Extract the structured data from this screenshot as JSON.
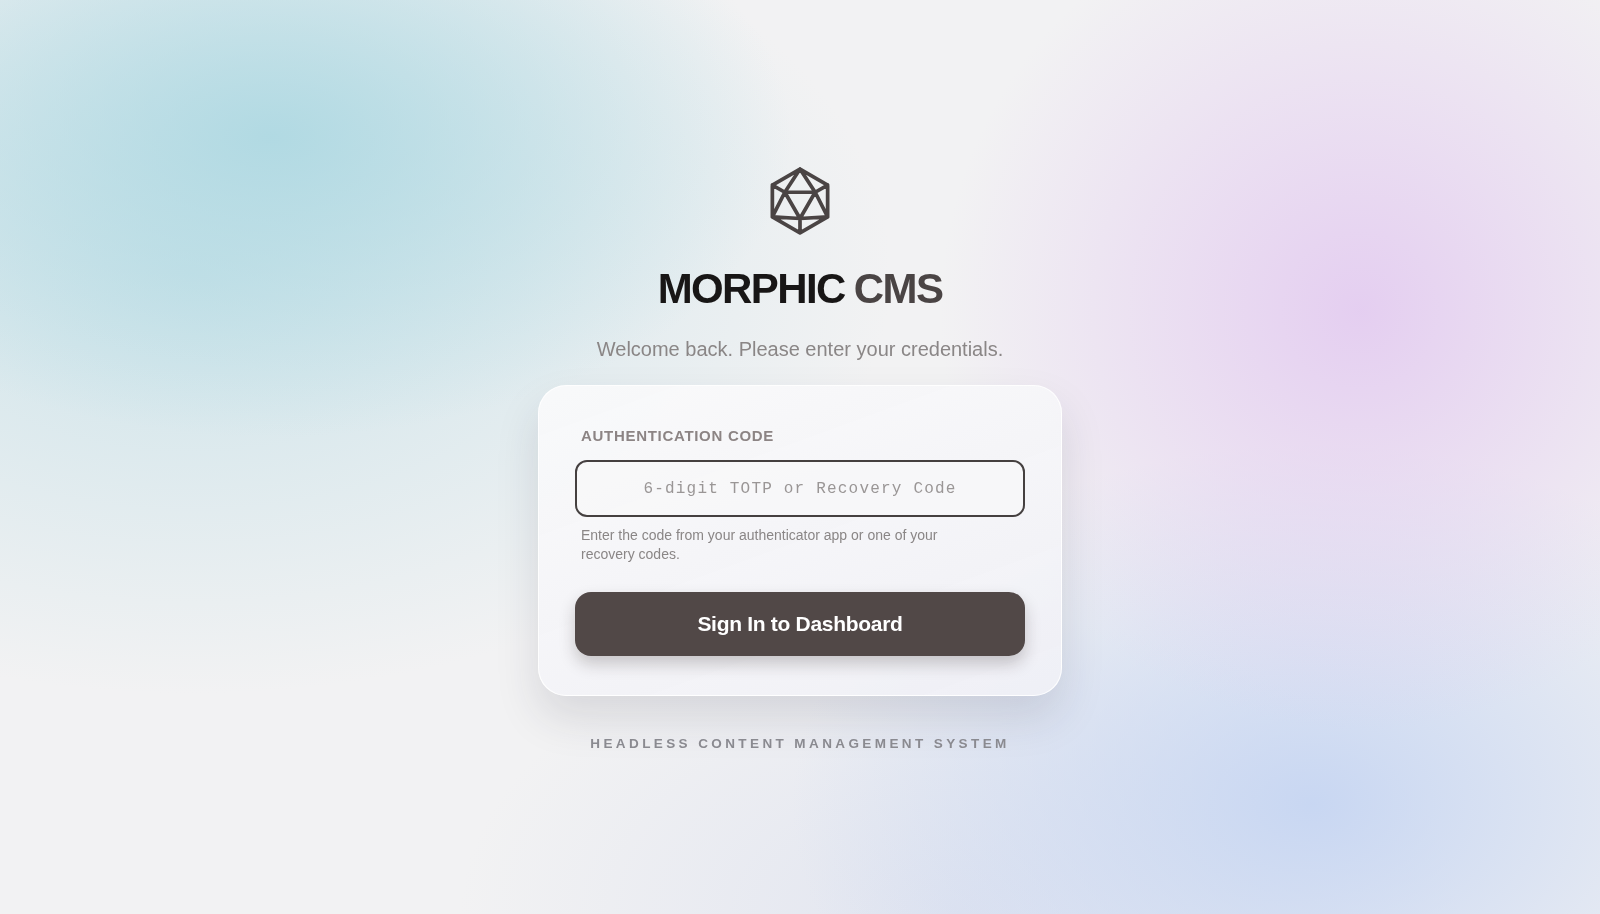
{
  "brand": {
    "name": "MORPHIC",
    "suffix": "CMS"
  },
  "subtitle": "Welcome back. Please enter your credentials.",
  "form": {
    "field": {
      "label": "AUTHENTICATION CODE",
      "placeholder": "6-digit TOTP or Recovery Code",
      "help": "Enter the code from your authenticator app or one of your recovery codes."
    },
    "submit": "Sign In to Dashboard"
  },
  "footer": "HEADLESS CONTENT MANAGEMENT SYSTEM"
}
